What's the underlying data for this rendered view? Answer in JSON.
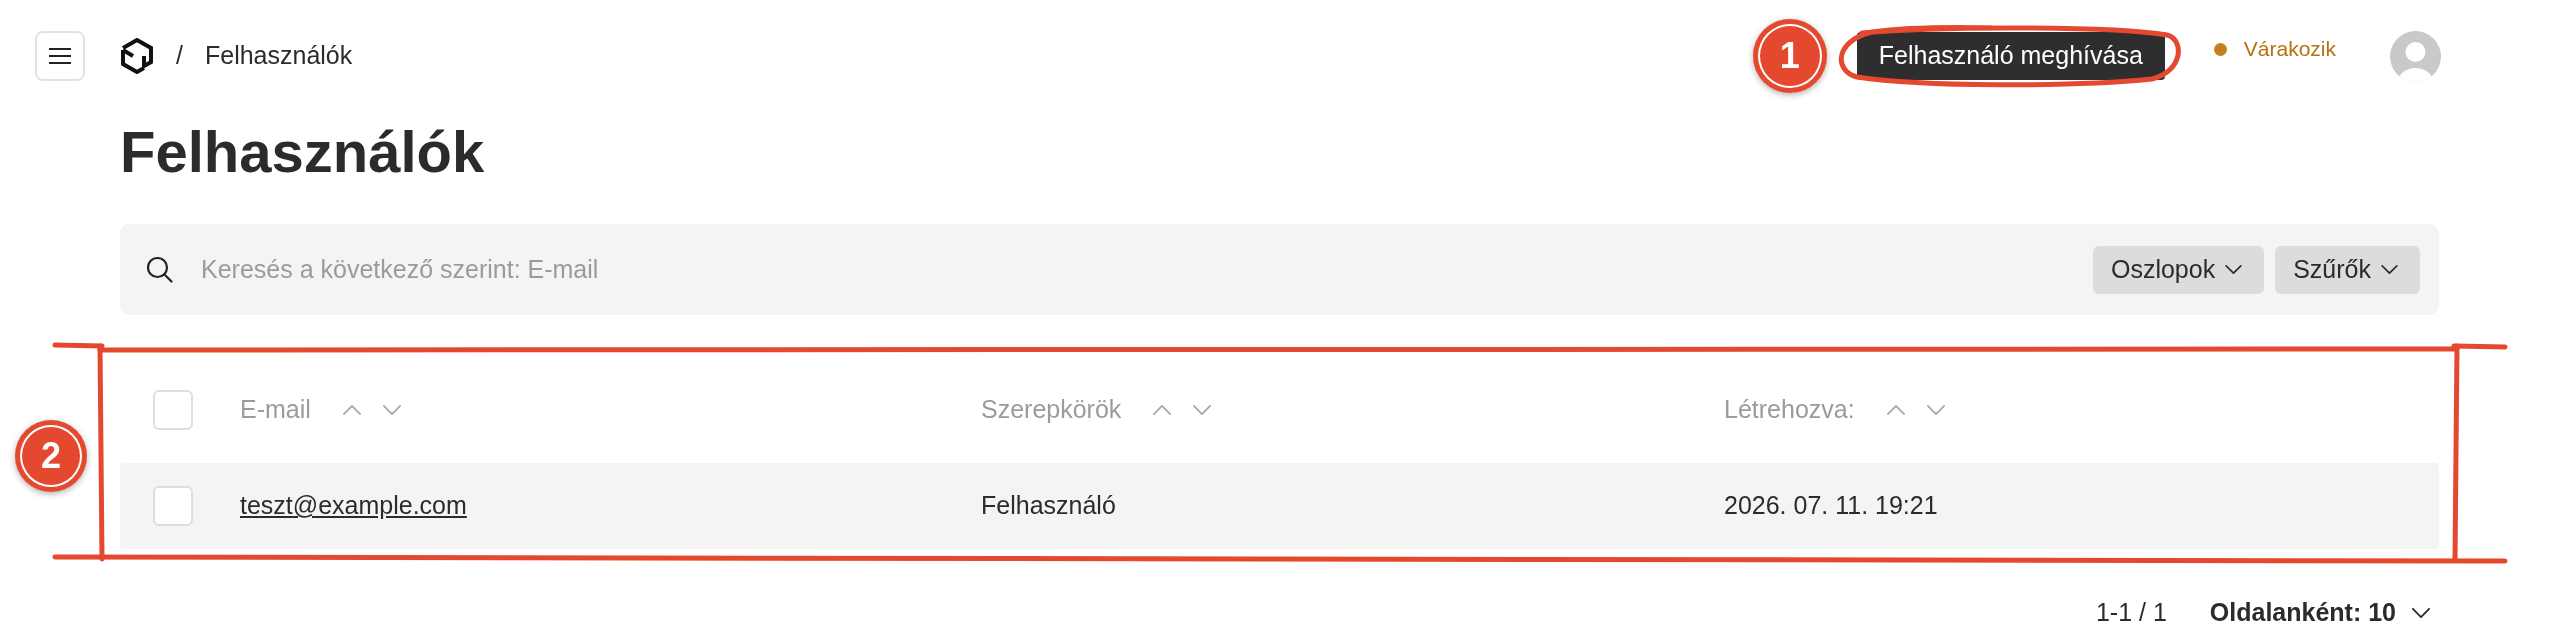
{
  "topbar": {
    "breadcrumb": {
      "separator": "/",
      "current": "Felhasználók"
    },
    "invite_button": {
      "label": "Felhasználó meghívása",
      "annotation": {
        "number": "1",
        "kind": "ellipse"
      }
    },
    "status": {
      "label": "Várakozik",
      "color": "#c4801a"
    }
  },
  "page_title": "Felhasználók",
  "search": {
    "placeholder": "Keresés a következő szerint: E-mail"
  },
  "toolbar_buttons": [
    "Oszlopok",
    "Szűrők"
  ],
  "table": {
    "annotation": {
      "number": "2",
      "kind": "frame"
    },
    "select_all": {
      "checked": false
    },
    "columns": [
      "E-mail",
      "Szerepkörök",
      "Létrehozva:"
    ],
    "rows": [
      {
        "checked": false,
        "email": "teszt@example.com",
        "role": "Felhasználó",
        "created": "2026. 07. 11. 19:21"
      }
    ]
  },
  "pagination": {
    "range": "1-1 / 1",
    "per_page": "Oldalanként: 10"
  }
}
